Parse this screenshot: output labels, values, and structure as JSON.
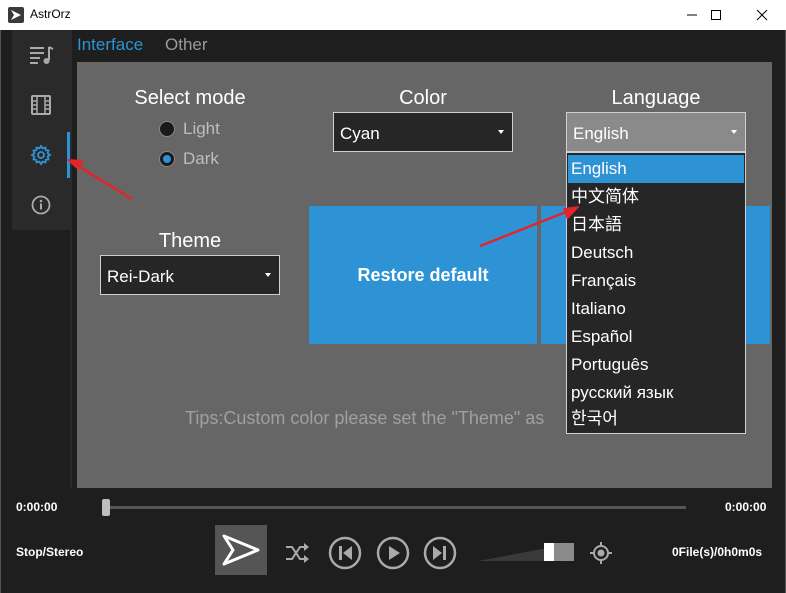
{
  "window": {
    "title": "AstrOrz"
  },
  "tabs": [
    {
      "label": "Interface",
      "active": true
    },
    {
      "label": "Other",
      "active": false
    }
  ],
  "sidebar": {
    "items": [
      {
        "icon": "playlist-icon",
        "active": false
      },
      {
        "icon": "film-icon",
        "active": false
      },
      {
        "icon": "gear-icon",
        "active": true
      },
      {
        "icon": "info-icon",
        "active": false
      }
    ]
  },
  "settings": {
    "select_mode": {
      "label": "Select mode",
      "options": [
        "Light",
        "Dark"
      ],
      "selected": "Dark"
    },
    "color": {
      "label": "Color",
      "value": "Cyan"
    },
    "language": {
      "label": "Language",
      "value": "English",
      "options": [
        "English",
        "中文简体",
        "日本語",
        "Deutsch",
        "Français",
        "Italiano",
        "Español",
        "Português",
        "русский язык",
        "한국어"
      ]
    },
    "theme": {
      "label": "Theme",
      "value": "Rei-Dark"
    },
    "restore_label": "Restore default",
    "tips": "Tips:Custom color please set the \"Theme\" as"
  },
  "player": {
    "time_current": "0:00:00",
    "time_total": "0:00:00",
    "progress": 0,
    "status": "Stop/Stereo",
    "volume": 0.75,
    "files": "0File(s)/0h0m0s"
  },
  "colors": {
    "accent": "#2e93d4",
    "panel": "#666666",
    "background": "#1e1e1e",
    "annotation": "#e0262b"
  }
}
